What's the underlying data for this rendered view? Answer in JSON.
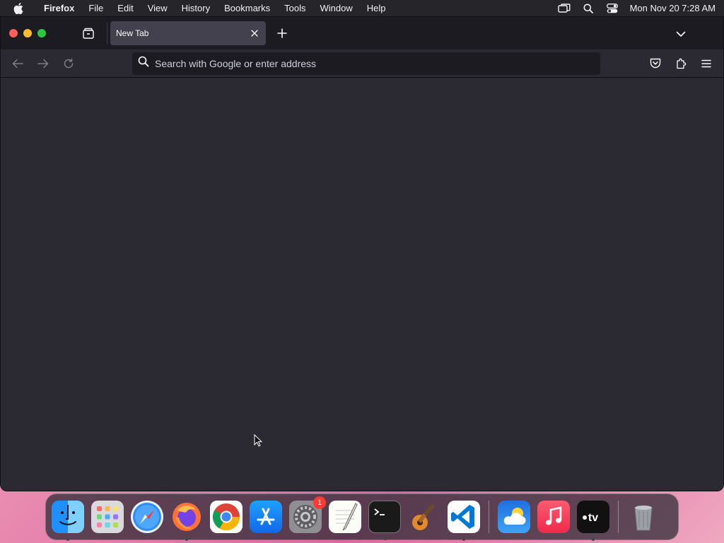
{
  "menubar": {
    "app_name": "Firefox",
    "items": [
      "File",
      "Edit",
      "View",
      "History",
      "Bookmarks",
      "Tools",
      "Window",
      "Help"
    ],
    "clock": "Mon Nov 20  7:28 AM"
  },
  "tabs": [
    {
      "title": "New Tab"
    }
  ],
  "urlbar": {
    "placeholder": "Search with Google or enter address",
    "value": ""
  },
  "dock": {
    "apps": [
      {
        "name": "Finder",
        "icon": "finder-icon",
        "running": true
      },
      {
        "name": "Launchpad",
        "icon": "launchpad-icon",
        "running": false
      },
      {
        "name": "Safari",
        "icon": "safari-icon",
        "running": false
      },
      {
        "name": "Firefox",
        "icon": "firefox-icon",
        "running": true
      },
      {
        "name": "Google Chrome",
        "icon": "chrome-icon",
        "running": false
      },
      {
        "name": "App Store",
        "icon": "app-store-icon",
        "running": false
      },
      {
        "name": "System Settings",
        "icon": "system-settings-icon",
        "running": false,
        "badge": "1"
      },
      {
        "name": "TextEdit",
        "icon": "textedit-icon",
        "running": false
      },
      {
        "name": "Terminal",
        "icon": "terminal-icon",
        "running": true
      },
      {
        "name": "GarageBand",
        "icon": "garageband-icon",
        "running": false
      },
      {
        "name": "Visual Studio Code",
        "icon": "vscode-icon",
        "running": true
      },
      {
        "name": "Weather",
        "icon": "weather-icon",
        "running": false
      },
      {
        "name": "Music",
        "icon": "music-icon",
        "running": false
      },
      {
        "name": "TV",
        "icon": "tv-icon",
        "running": true
      },
      {
        "name": "Trash",
        "icon": "trash-icon",
        "running": false
      }
    ]
  },
  "colors": {
    "window_bg": "#2b2a33",
    "tabstrip_bg": "#1c1b22",
    "active_tab_bg": "#42414d",
    "urlbar_bg": "#1c1b22"
  }
}
